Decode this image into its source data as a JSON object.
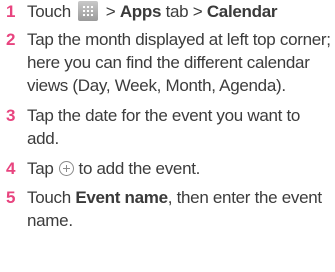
{
  "steps": [
    {
      "number": "1",
      "touch": "Touch",
      "apps_icon": "apps-grid-icon",
      "sep1": ">",
      "apps": "Apps",
      "tab": "tab",
      "sep2": ">",
      "calendar": "Calendar"
    },
    {
      "number": "2",
      "text": "Tap the month displayed at left top corner; here you can find the different calendar views (Day, Week, Month, Agenda)."
    },
    {
      "number": "3",
      "text": "Tap the date for the event you want to add."
    },
    {
      "number": "4",
      "tap": "Tap",
      "add_icon": "add-circle-icon",
      "rest": "to add the event."
    },
    {
      "number": "5",
      "touch": "Touch",
      "event_name": "Event name",
      "rest": ", then enter the event name."
    }
  ],
  "colors": {
    "number": "#e8447f",
    "text": "#3c3c3c"
  }
}
